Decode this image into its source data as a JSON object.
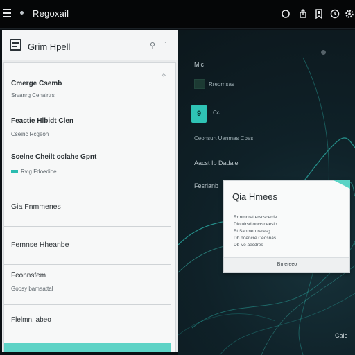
{
  "topbar": {
    "title": "Regoxail",
    "icons": [
      "menu-icon",
      "circle-icon",
      "share-icon",
      "bookmark-icon",
      "clock-icon",
      "settings-icon"
    ]
  },
  "left_panel": {
    "header_title": "Grim Hpell",
    "header_icons": [
      "pin-icon",
      "expand-icon"
    ],
    "items": [
      {
        "title": "Cmerge Csemb",
        "subtitle": "Srvanrg Cenalrtrs"
      },
      {
        "title": "Feactie Hlbidt Clen",
        "subtitle": "Cseinc Rcgeon"
      },
      {
        "title": "Scelne Cheilt oclahe Gpnt",
        "subtitle": "Rvig Fdoedioe"
      },
      {
        "title": "Gia Fnmmenes",
        "subtitle": ""
      },
      {
        "title": "Femnse Hheanbe",
        "subtitle": ""
      },
      {
        "title": "Feonnsfem",
        "subtitle": "Goosy bamaattal"
      },
      {
        "title": "Flelmn, abeo",
        "subtitle": ""
      }
    ]
  },
  "right_panel": {
    "label_1": "Mic",
    "label_1_sub": "Rreornsas",
    "teal_badge": "9",
    "teal_badge_label": "Cc",
    "line_a": "Ceonsurt Uanmas Cbes",
    "line_b": "Aacst Ib Dadale",
    "line_c": "Fesrlanb",
    "corner_label": "Cale"
  },
  "modal": {
    "title": "Qia Hmees",
    "lines": [
      "Rr nmrlrat erscscerde",
      "Dlo ulrsd oncrsneeslo",
      "Bt Sanmeroraresg",
      "Db noencre Ceosnas",
      "Db Vo aecdres"
    ],
    "button_label": "Bmereeo"
  },
  "colors": {
    "accent": "#2fc3b5",
    "accent_light": "#5ed3c6",
    "topbar_bg": "#050607",
    "panel_bg": "#f7f8f8",
    "dark_bg": "#0f2128"
  }
}
